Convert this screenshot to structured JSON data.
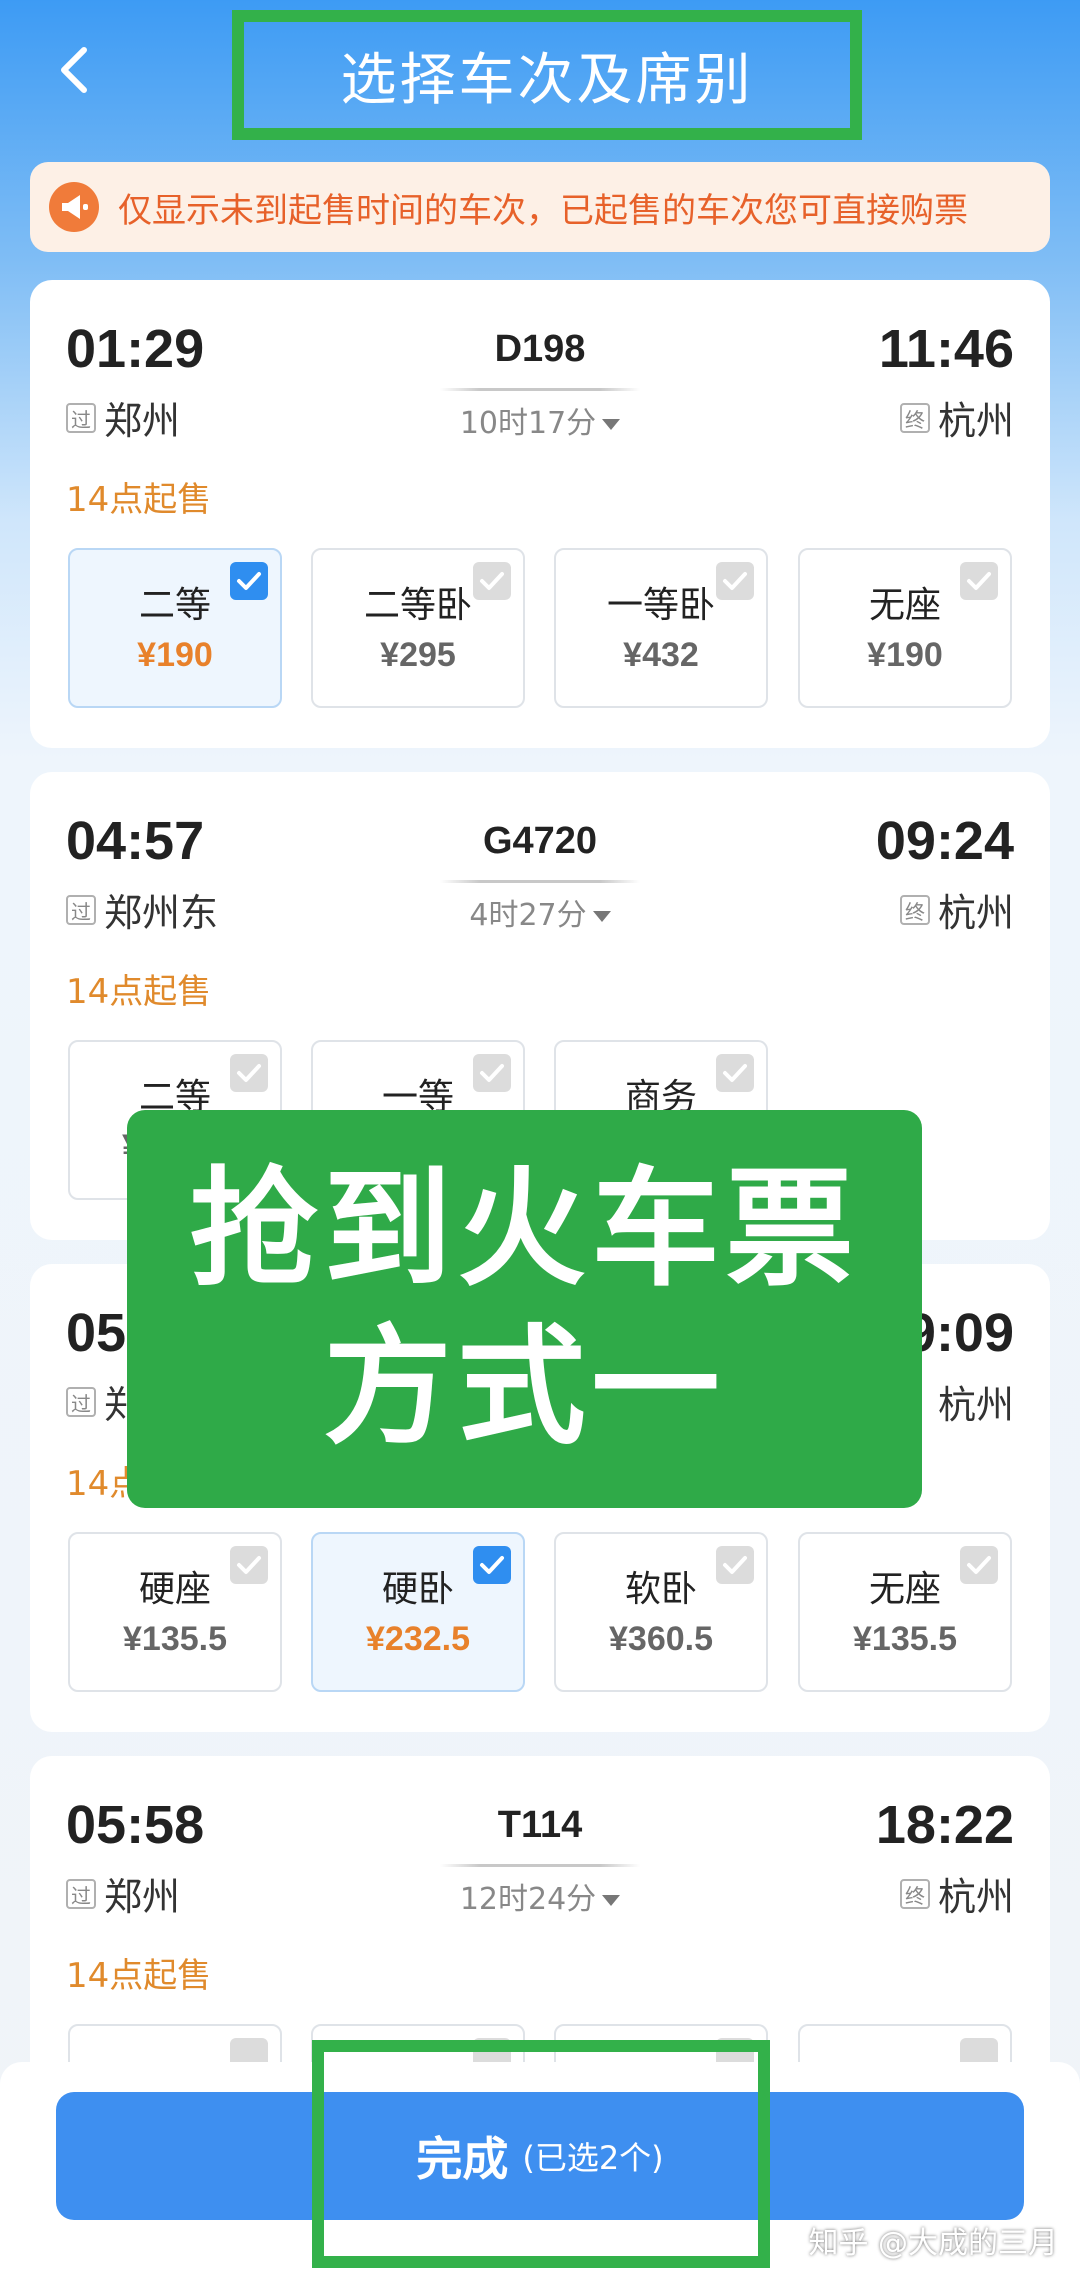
{
  "header": {
    "title": "选择车次及席别"
  },
  "notice": {
    "text": "仅显示未到起售时间的车次，已起售的车次您可直接购票"
  },
  "trains": [
    {
      "dep_time": "01:29",
      "train_no": "D198",
      "arr_time": "11:46",
      "dep_tag": "过",
      "dep_station": "郑州",
      "duration": "10时17分",
      "arr_tag": "终",
      "arr_station": "杭州",
      "sale_time": "14点起售",
      "seats": [
        {
          "name": "二等",
          "price": "¥190",
          "selected": true
        },
        {
          "name": "二等卧",
          "price": "¥295",
          "selected": false
        },
        {
          "name": "一等卧",
          "price": "¥432",
          "selected": false
        },
        {
          "name": "无座",
          "price": "¥190",
          "selected": false
        }
      ]
    },
    {
      "dep_time": "04:57",
      "train_no": "G4720",
      "arr_time": "09:24",
      "dep_tag": "过",
      "dep_station": "郑州东",
      "duration": "4时27分",
      "arr_tag": "终",
      "arr_station": "杭州",
      "sale_time": "14点起售",
      "seats": [
        {
          "name": "二等",
          "price": "¥",
          "selected": false
        },
        {
          "name": "一等",
          "price": "",
          "selected": false
        },
        {
          "name": "商务",
          "price": "",
          "selected": false
        }
      ]
    },
    {
      "dep_time": "05",
      "arr_time": "9:09",
      "dep_tag": "过",
      "dep_station": "郑",
      "arr_station": "杭州",
      "sale_time": "14点",
      "seats": [
        {
          "name": "硬座",
          "price": "¥135.5",
          "selected": false
        },
        {
          "name": "硬卧",
          "price": "¥232.5",
          "selected": true
        },
        {
          "name": "软卧",
          "price": "¥360.5",
          "selected": false
        },
        {
          "name": "无座",
          "price": "¥135.5",
          "selected": false
        }
      ]
    },
    {
      "dep_time": "05:58",
      "train_no": "T114",
      "arr_time": "18:22",
      "dep_tag": "过",
      "dep_station": "郑州",
      "duration": "12时24分",
      "arr_tag": "终",
      "arr_station": "杭州",
      "sale_time": "14点起售"
    }
  ],
  "overlay": {
    "line1": "抢到火车票",
    "line2": "方式一"
  },
  "footer": {
    "done_label": "完成",
    "done_count": "(已选2个)"
  },
  "watermark": {
    "text": "知乎 @大成的三月"
  },
  "colors": {
    "accent": "#3e8ff0",
    "overlay_green": "#2faa48",
    "frame_green": "#33b14a",
    "selected_price": "#e8812b",
    "notice_text": "#e7612a"
  }
}
